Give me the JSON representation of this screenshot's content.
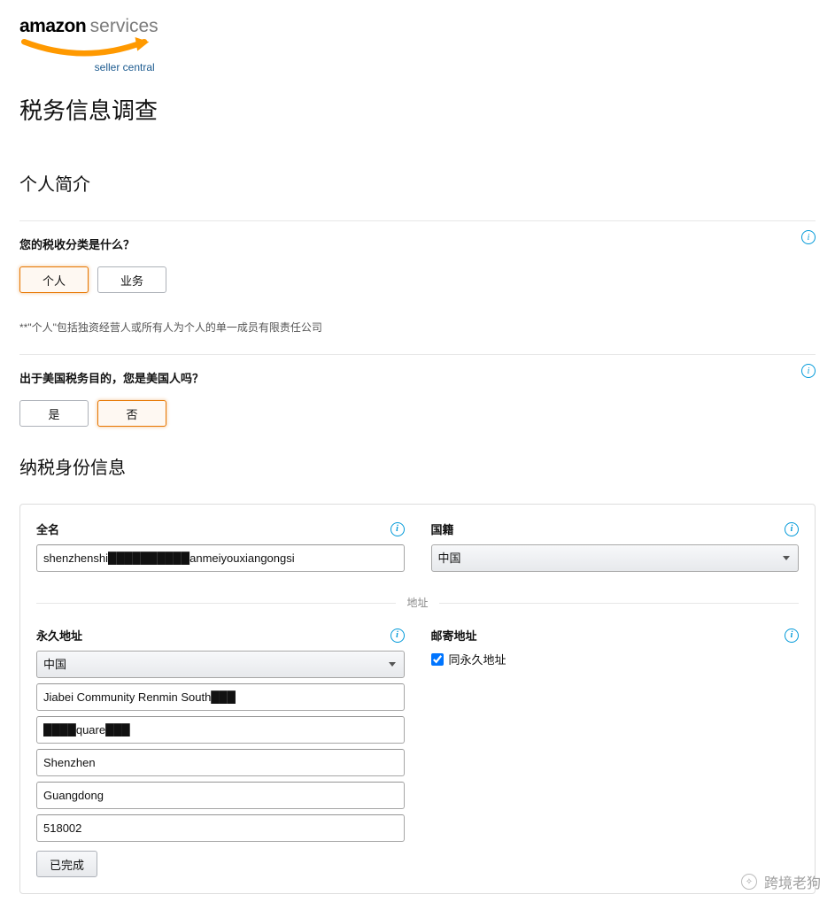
{
  "logo": {
    "brand": "amazon",
    "suffix": "services",
    "subtitle": "seller central"
  },
  "page_title": "税务信息调查",
  "profile_section_title": "个人简介",
  "q1": {
    "label": "您的税收分类是什么？",
    "option_individual": "个人",
    "option_business": "业务",
    "hint": "**\"个人\"包括独资经营人或所有人为个人的单一成员有限责任公司"
  },
  "q2": {
    "label": "出于美国税务目的，您是美国人吗？",
    "option_yes": "是",
    "option_no": "否"
  },
  "identity_section_title": "纳税身份信息",
  "fullname": {
    "label": "全名",
    "value": "shenzhenshi██████████anmeiyouxiangongsi"
  },
  "nationality": {
    "label": "国籍",
    "value": "中国"
  },
  "address_divider": "地址",
  "perm_address": {
    "label": "永久地址",
    "country": "中国",
    "line1": "Jiabei Community Renmin South███",
    "line2": "████quare███",
    "city": "Shenzhen",
    "province": "Guangdong",
    "postal": "518002",
    "done_label": "已完成"
  },
  "mail_address": {
    "label": "邮寄地址",
    "same_as_label": "同永久地址",
    "same_as_checked": true
  },
  "watermark": "跨境老狗"
}
